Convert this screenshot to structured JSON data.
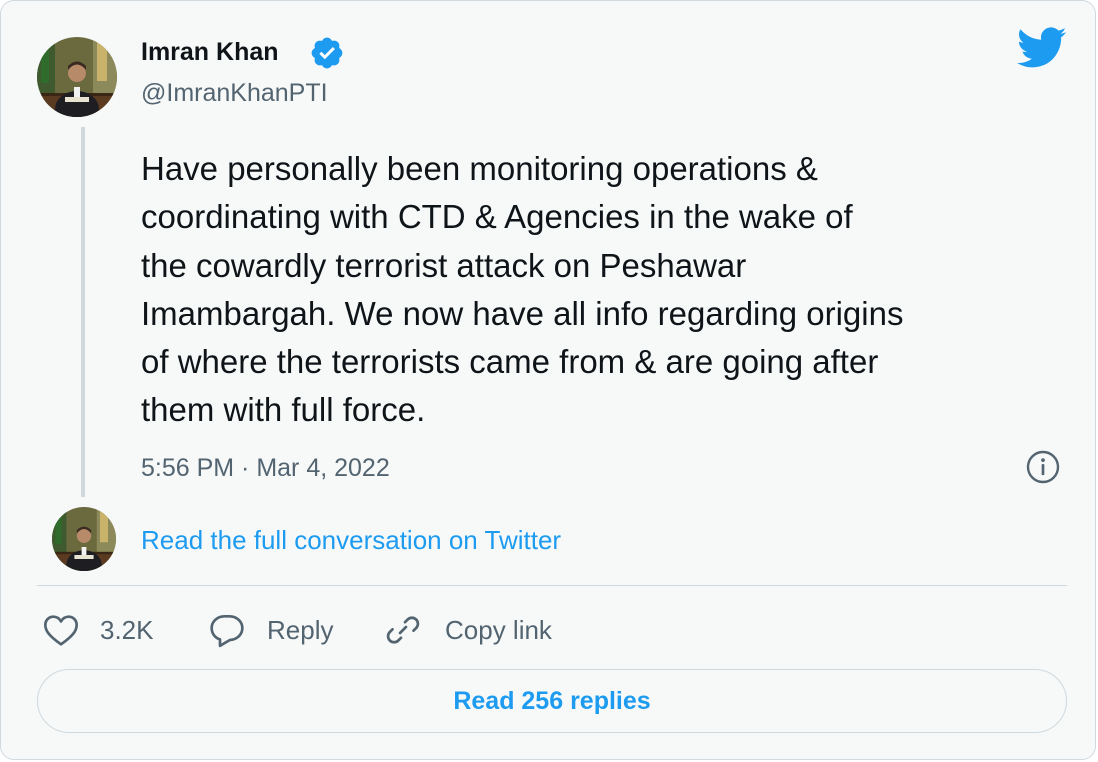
{
  "author": {
    "name": "Imran Khan",
    "handle": "@ImranKhanPTI",
    "verified_icon": "verified-badge-icon",
    "avatar": "profile-photo"
  },
  "tweet": {
    "text": "Have personally been monitoring operations &\ncoordinating with CTD & Agencies in the wake of\nthe cowardly terrorist attack on Peshawar\nImambargah. We now have all info regarding origins\nof where the terrorists came from & are going after\nthem with full force.",
    "timestamp": "5:56 PM · Mar 4, 2022"
  },
  "conversation": {
    "link_label": "Read the full conversation on Twitter"
  },
  "actions": {
    "like_count": "3.2K",
    "reply_label": "Reply",
    "copy_link_label": "Copy link"
  },
  "footer": {
    "read_replies_label": "Read 256 replies"
  },
  "icons": {
    "brand": "twitter-bird-icon",
    "info": "info-icon",
    "like": "heart-icon",
    "reply": "speech-bubble-icon",
    "copy": "link-icon"
  },
  "colors": {
    "brand_blue": "#1d9bf0",
    "text_primary": "#0f1419",
    "text_secondary": "#536471",
    "border": "#cfd9de",
    "background": "#f7f9f9"
  }
}
